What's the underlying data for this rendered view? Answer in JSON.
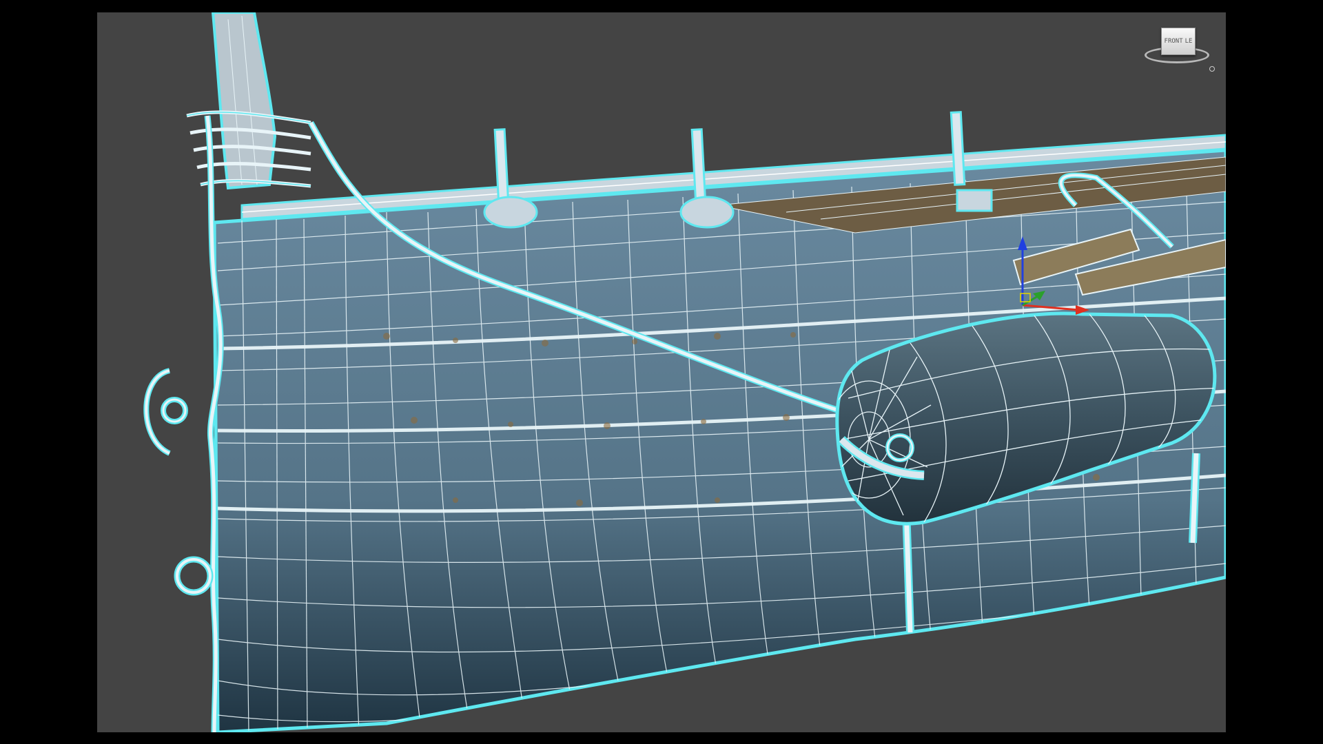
{
  "viewport": {
    "viewcube_label": "FRONT",
    "viewcube_side_label": "LE",
    "wire_color": "#e8f4f8",
    "selection_outline_color": "#5ee8f0",
    "hull_color": "#5f7e93",
    "background_color": "#444444"
  },
  "gizmo": {
    "x_axis_color": "#e03020",
    "y_axis_color": "#2aa02a",
    "z_axis_color": "#2040e0"
  },
  "icons": [
    "viewcube-icon",
    "transform-gizmo-icon"
  ]
}
